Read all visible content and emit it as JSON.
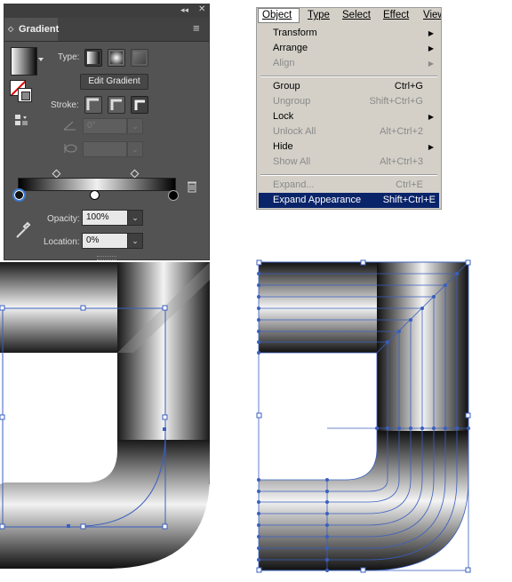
{
  "panel": {
    "collapse_glyph": "◂◂",
    "close_glyph": "✕",
    "title": "Gradient",
    "tab_chevron": "◇",
    "menu_glyph": "≡",
    "type_label": "Type:",
    "edit_gradient_label": "Edit Gradient",
    "stroke_label": "Stroke:",
    "angle_value": "0°",
    "opacity_label": "Opacity:",
    "opacity_value": "100%",
    "location_label": "Location:",
    "location_value": "0%",
    "dropdown_glyph": "⌄",
    "trash_glyph": "🗑"
  },
  "menu": {
    "bar": [
      "Object",
      "Type",
      "Select",
      "Effect",
      "View"
    ],
    "items": [
      {
        "label": "Transform",
        "shortcut": "",
        "submenu": true,
        "disabled": false
      },
      {
        "label": "Arrange",
        "shortcut": "",
        "submenu": true,
        "disabled": false
      },
      {
        "label": "Align",
        "shortcut": "",
        "submenu": true,
        "disabled": true
      },
      {
        "label": "Group",
        "shortcut": "Ctrl+G",
        "submenu": false,
        "disabled": false
      },
      {
        "label": "Ungroup",
        "shortcut": "Shift+Ctrl+G",
        "submenu": false,
        "disabled": true
      },
      {
        "label": "Lock",
        "shortcut": "",
        "submenu": true,
        "disabled": false
      },
      {
        "label": "Unlock All",
        "shortcut": "Alt+Ctrl+2",
        "submenu": false,
        "disabled": true
      },
      {
        "label": "Hide",
        "shortcut": "",
        "submenu": true,
        "disabled": false
      },
      {
        "label": "Show All",
        "shortcut": "Alt+Ctrl+3",
        "submenu": false,
        "disabled": true
      },
      {
        "label": "Expand...",
        "shortcut": "Ctrl+E",
        "submenu": false,
        "disabled": true
      },
      {
        "label": "Expand Appearance",
        "shortcut": "Shift+Ctrl+E",
        "submenu": false,
        "disabled": false,
        "selected": true
      }
    ],
    "submenu_arrow": "▶"
  },
  "colors": {
    "panel_bg": "#535353",
    "menu_bg": "#d4d0c8",
    "menu_highlight": "#0a246a",
    "selection_blue": "#3a5fbf"
  }
}
